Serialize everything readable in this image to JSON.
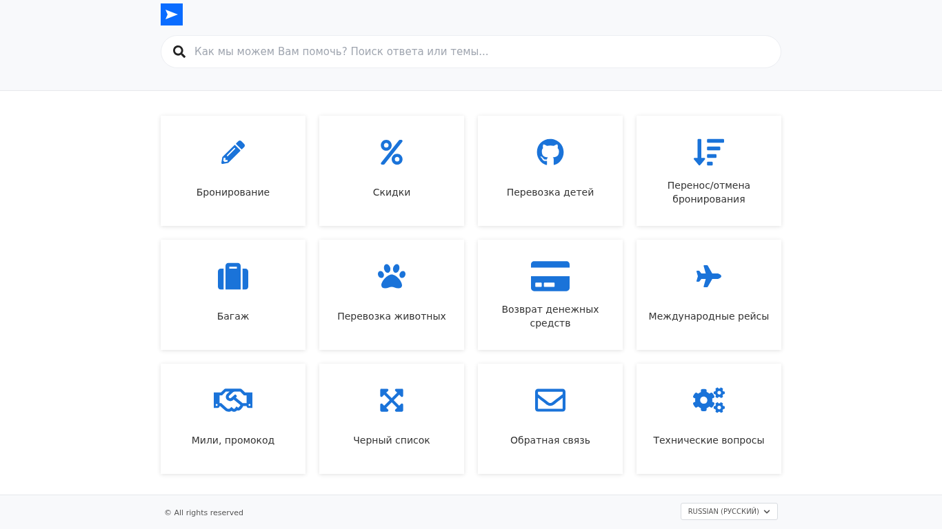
{
  "search": {
    "placeholder": "Как мы можем Вам помочь? Поиск ответа или темы..."
  },
  "categories": [
    {
      "label": "Бронирование"
    },
    {
      "label": "Скидки"
    },
    {
      "label": "Перевозка детей"
    },
    {
      "label": "Перенос/отмена бронирования"
    },
    {
      "label": "Багаж"
    },
    {
      "label": "Перевозка животных"
    },
    {
      "label": "Возврат денежных средств"
    },
    {
      "label": "Международные рейсы"
    },
    {
      "label": "Мили, промокод"
    },
    {
      "label": "Черный список"
    },
    {
      "label": "Обратная связь"
    },
    {
      "label": "Технические вопросы"
    }
  ],
  "footer": {
    "copyright": "© All rights reserved",
    "language": "RUSSIAN (РУССКИЙ)"
  }
}
